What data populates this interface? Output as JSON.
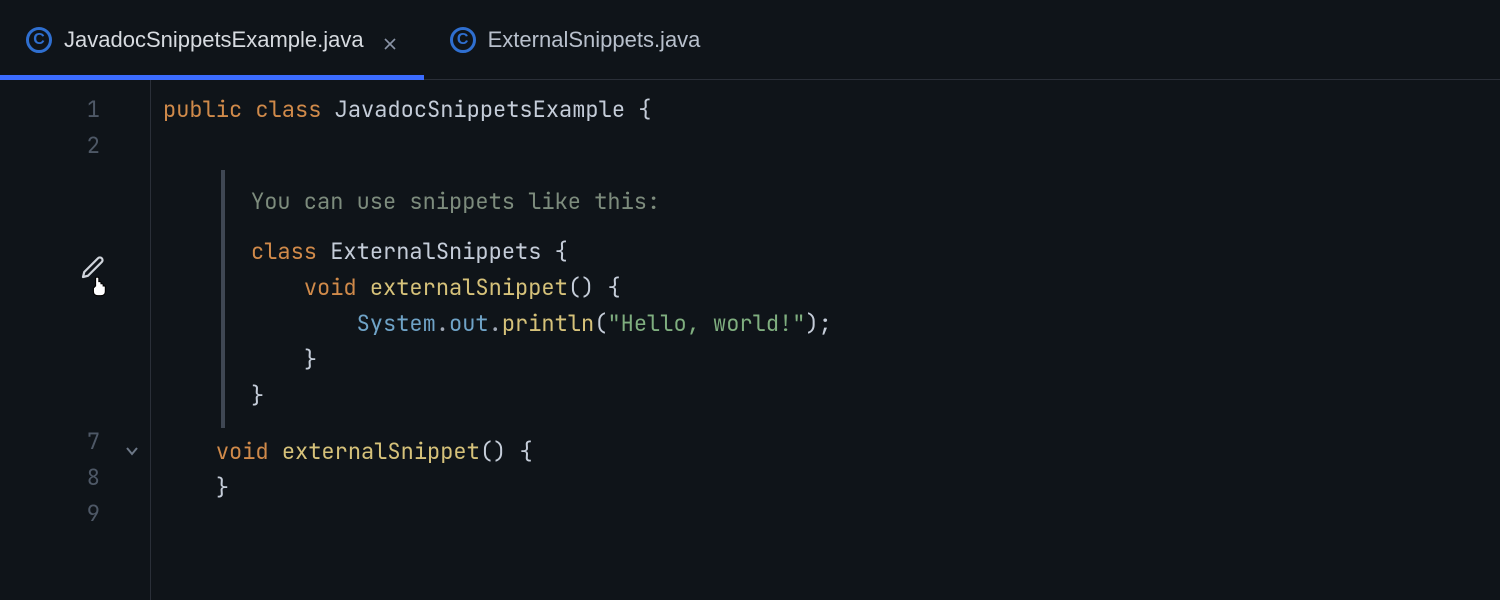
{
  "tabs": [
    {
      "label": "JavadocSnippetsExample.java",
      "active": true,
      "closable": true
    },
    {
      "label": "ExternalSnippets.java",
      "active": false,
      "closable": false
    }
  ],
  "gutter": {
    "lines": [
      "1",
      "2",
      "7",
      "8",
      "9"
    ]
  },
  "code": {
    "l1": {
      "t0": "public",
      "t1": "class",
      "t2": "JavadocSnippetsExample",
      "t3": "{"
    },
    "doc": {
      "desc": "You can use snippets like this:",
      "s0": {
        "t0": "class",
        "t1": "ExternalSnippets",
        "t2": "{"
      },
      "s1": {
        "t0": "void",
        "t1": "externalSnippet",
        "t2": "()",
        "t3": "{"
      },
      "s2": {
        "t0": "System",
        "dot1": ".",
        "t1": "out",
        "dot2": ".",
        "t2": "println",
        "t3": "(",
        "t4": "\"Hello, world!\"",
        "t5": ");"
      },
      "s3": "}",
      "s4": "}"
    },
    "l7": {
      "t0": "void",
      "t1": "externalSnippet",
      "t2": "()",
      "t3": "{"
    },
    "l8": "}"
  },
  "colors": {
    "background": "#0f1419",
    "accent": "#3b6cff",
    "keyword": "#d08a4a",
    "function": "#d6c27a",
    "identifier": "#6fa3c7",
    "string": "#7fae7f",
    "comment": "#7d8c7d",
    "gutter": "#4e5866"
  }
}
